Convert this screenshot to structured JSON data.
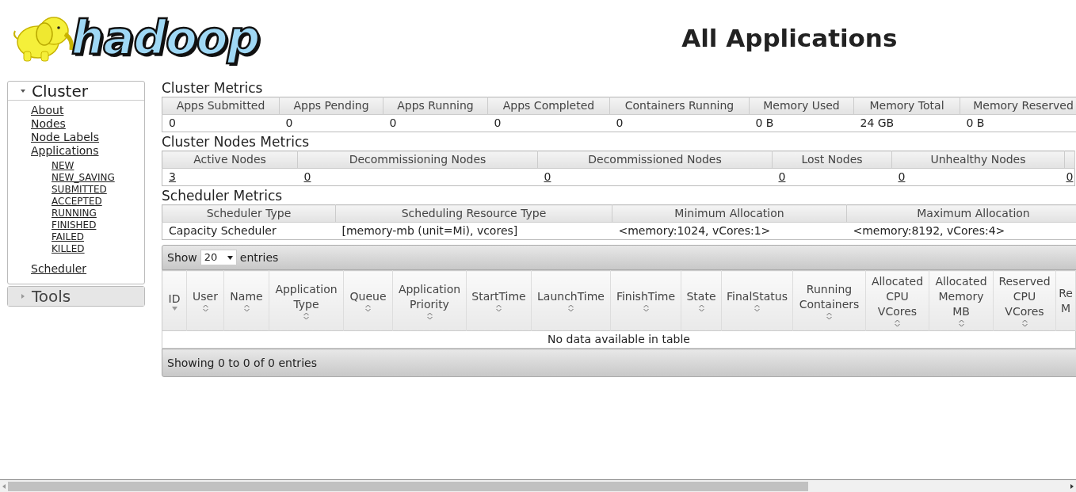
{
  "logo": {
    "text": "hadoop"
  },
  "page_title": "All Applications",
  "sidebar": {
    "sections": [
      {
        "title": "Cluster",
        "expanded": true,
        "items": [
          {
            "label": "About"
          },
          {
            "label": "Nodes"
          },
          {
            "label": "Node Labels"
          },
          {
            "label": "Applications",
            "children": [
              {
                "label": "NEW"
              },
              {
                "label": "NEW_SAVING"
              },
              {
                "label": "SUBMITTED"
              },
              {
                "label": "ACCEPTED"
              },
              {
                "label": "RUNNING"
              },
              {
                "label": "FINISHED"
              },
              {
                "label": "FAILED"
              },
              {
                "label": "KILLED"
              }
            ]
          },
          {
            "label": "Scheduler"
          }
        ]
      },
      {
        "title": "Tools",
        "expanded": false
      }
    ]
  },
  "metric_tables": [
    {
      "title": "Cluster Metrics",
      "columns": [
        {
          "header": "Apps Submitted",
          "value": "0",
          "link": false
        },
        {
          "header": "Apps Pending",
          "value": "0",
          "link": false
        },
        {
          "header": "Apps Running",
          "value": "0",
          "link": false
        },
        {
          "header": "Apps Completed",
          "value": "0",
          "link": false
        },
        {
          "header": "Containers Running",
          "value": "0",
          "link": false
        },
        {
          "header": "Memory Used",
          "value": "0 B",
          "link": false
        },
        {
          "header": "Memory Total",
          "value": "24 GB",
          "link": false
        },
        {
          "header": "Memory Reserved",
          "value": "0 B",
          "link": false
        }
      ]
    },
    {
      "title": "Cluster Nodes Metrics",
      "columns": [
        {
          "header": "Active Nodes",
          "value": "3",
          "link": true
        },
        {
          "header": "Decommissioning Nodes",
          "value": "0",
          "link": true
        },
        {
          "header": "Decommissioned Nodes",
          "value": "0",
          "link": true
        },
        {
          "header": "Lost Nodes",
          "value": "0",
          "link": true
        },
        {
          "header": "Unhealthy Nodes",
          "value": "0",
          "link": true
        },
        {
          "value": "0",
          "link": true
        }
      ]
    },
    {
      "title": "Scheduler Metrics",
      "columns": [
        {
          "header": "Scheduler Type",
          "value": "Capacity Scheduler",
          "link": false
        },
        {
          "header": "Scheduling Resource Type",
          "value": "[memory-mb (unit=Mi), vcores]",
          "link": false
        },
        {
          "header": "Minimum Allocation",
          "value": "<memory:1024, vCores:1>",
          "link": false
        },
        {
          "header": "Maximum Allocation",
          "value": "<memory:8192, vCores:4>",
          "link": false
        }
      ]
    }
  ],
  "apps_table": {
    "length_label_before": "Show",
    "page_length": "20",
    "length_label_after": "entries",
    "columns": [
      {
        "lines": [
          "ID"
        ],
        "sorted": true
      },
      {
        "lines": [
          "User"
        ],
        "sorted": false
      },
      {
        "lines": [
          "Name"
        ],
        "sorted": false
      },
      {
        "lines": [
          "Application",
          "Type"
        ],
        "sorted": false
      },
      {
        "lines": [
          "Queue"
        ],
        "sorted": false
      },
      {
        "lines": [
          "Application",
          "Priority"
        ],
        "sorted": false
      },
      {
        "lines": [
          "StartTime"
        ],
        "sorted": false
      },
      {
        "lines": [
          "LaunchTime"
        ],
        "sorted": false
      },
      {
        "lines": [
          "FinishTime"
        ],
        "sorted": false
      },
      {
        "lines": [
          "State"
        ],
        "sorted": false
      },
      {
        "lines": [
          "FinalStatus"
        ],
        "sorted": false
      },
      {
        "lines": [
          "Running",
          "Containers"
        ],
        "sorted": false
      },
      {
        "lines": [
          "Allocated",
          "CPU",
          "VCores"
        ],
        "sorted": false
      },
      {
        "lines": [
          "Allocated",
          "Memory",
          "MB"
        ],
        "sorted": false
      },
      {
        "lines": [
          "Reserved",
          "CPU",
          "VCores"
        ],
        "sorted": false
      },
      {
        "lines": [
          "Re",
          "M"
        ]
      }
    ],
    "empty_message": "No data available in table",
    "info": "Showing 0 to 0 of 0 entries"
  }
}
